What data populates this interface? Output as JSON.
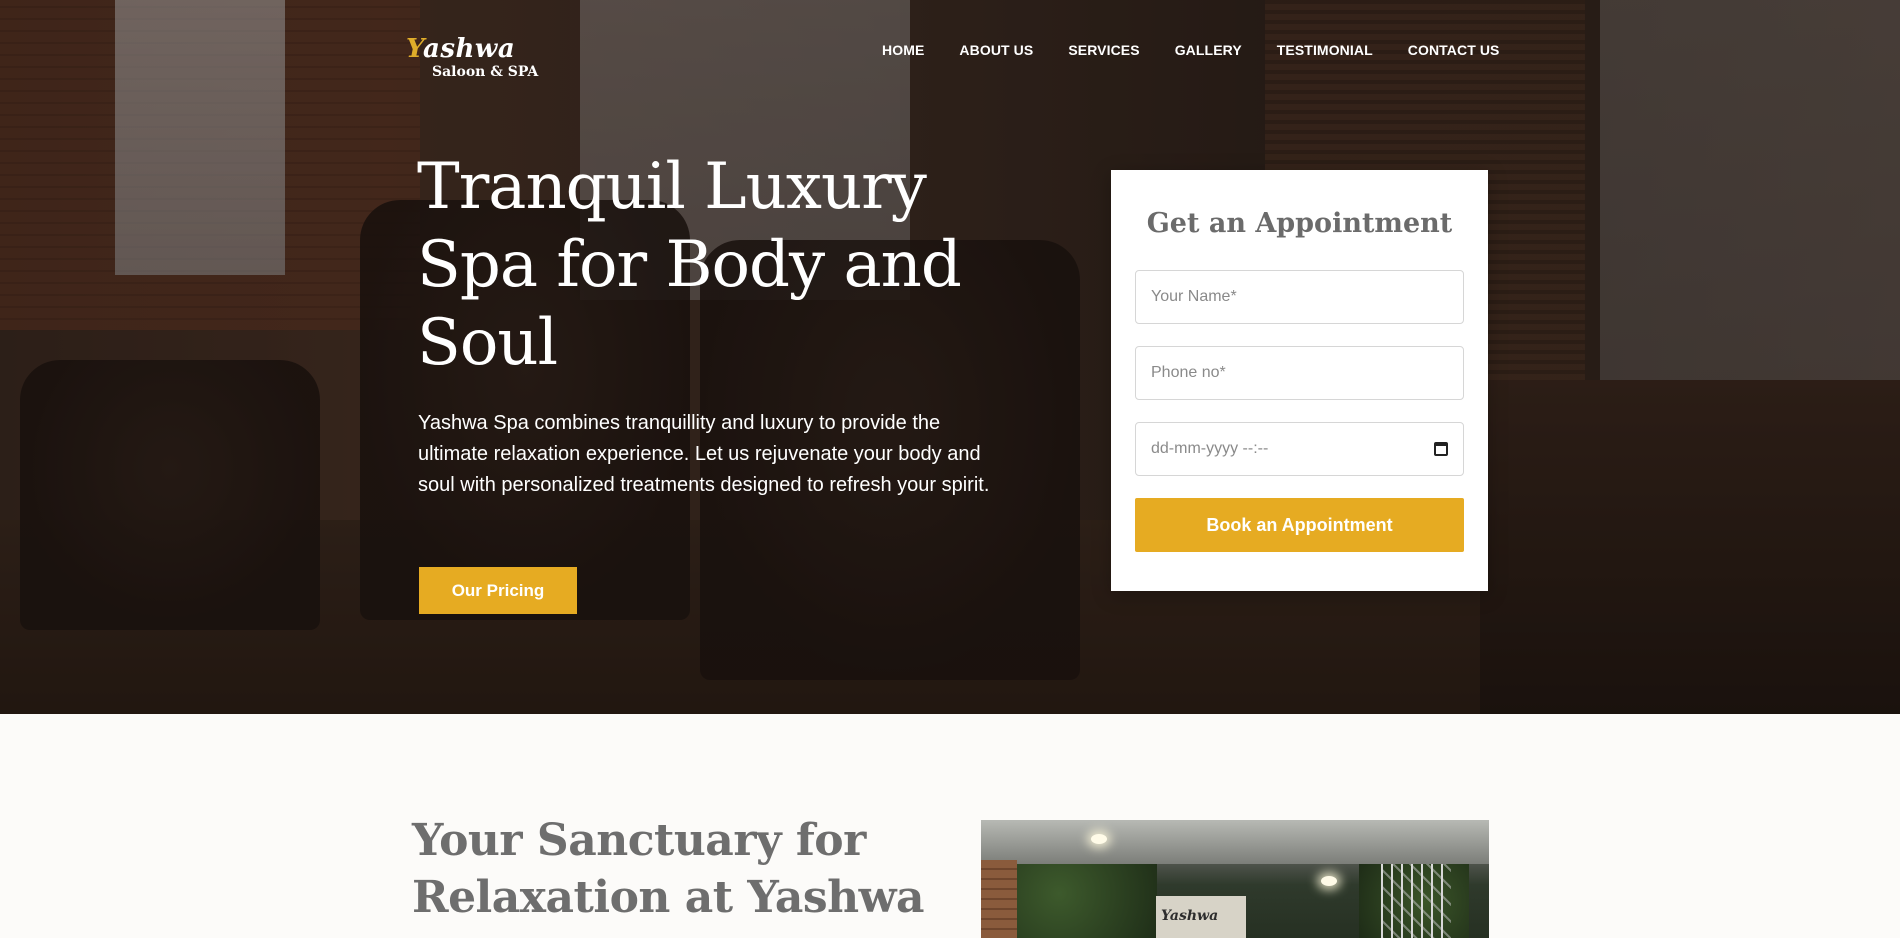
{
  "brand": {
    "name": "Yashwa",
    "tagline": "Saloon & SPA"
  },
  "nav": {
    "items": [
      {
        "label": "HOME"
      },
      {
        "label": "ABOUT US"
      },
      {
        "label": "SERVICES"
      },
      {
        "label": "GALLERY"
      },
      {
        "label": "TESTIMONIAL"
      },
      {
        "label": "CONTACT US"
      }
    ]
  },
  "hero": {
    "title": "Tranquil Luxury Spa for Body and Soul",
    "description": "Yashwa Spa combines tranquillity and luxury to provide the ultimate relaxation experience. Let us rejuvenate your body and soul with personalized treatments designed to refresh your spirit.",
    "cta_label": "Our Pricing"
  },
  "appointment": {
    "title": "Get an Appointment",
    "name_placeholder": "Your Name*",
    "phone_placeholder": "Phone no*",
    "date_placeholder": "dd-mm-yyyy --:--",
    "submit_label": "Book an Appointment"
  },
  "section2": {
    "title": "Your Sanctuary for Relaxation at Yashwa",
    "photo_sign": "Yashwa"
  },
  "colors": {
    "accent": "#e6ab22",
    "heading_gray": "#6e6e6e",
    "page_background": "#fcfbf9"
  }
}
